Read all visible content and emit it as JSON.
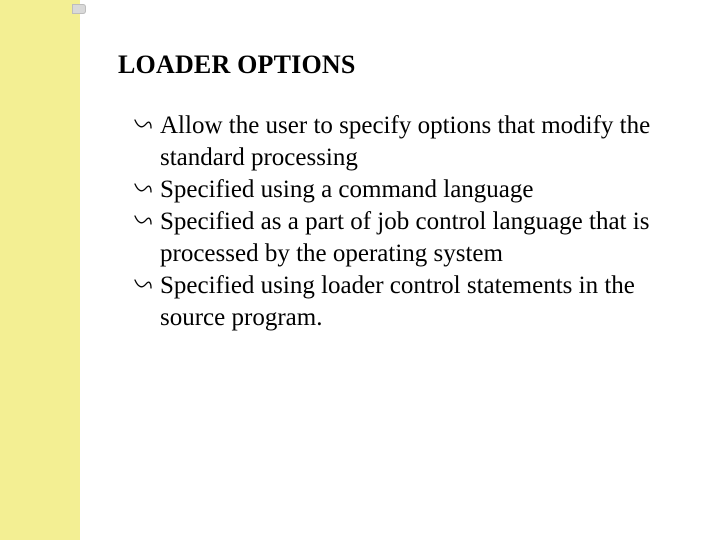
{
  "title": "LOADER OPTIONS",
  "bullets": [
    "Allow the user to specify options that modify the standard processing",
    "Specified using a command language",
    "Specified as a part of job control language that is processed by the operating system",
    "Specified using loader control statements in the source program."
  ]
}
